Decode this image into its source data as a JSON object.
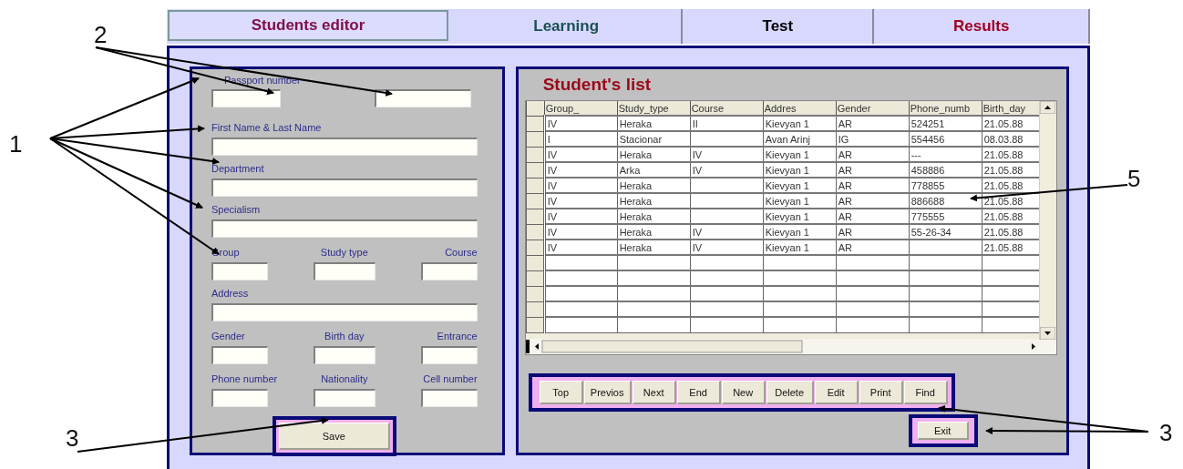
{
  "tabs": [
    {
      "label": "Students editor",
      "selected": true,
      "color": "#80104a"
    },
    {
      "label": "Learning",
      "selected": false,
      "color": "#1a5050"
    },
    {
      "label": "Test",
      "selected": false,
      "color": "#000000"
    },
    {
      "label": "Results",
      "selected": false,
      "color": "#a00020"
    }
  ],
  "editor": {
    "rows": [
      {
        "kind": "passport",
        "label": "Passport number"
      },
      {
        "kind": "full",
        "label": "First Name & Last Name"
      },
      {
        "kind": "full",
        "label": "Department"
      },
      {
        "kind": "full",
        "label": "Specialism"
      },
      {
        "kind": "triple",
        "labels": [
          "Group",
          "Study type",
          "Course"
        ]
      },
      {
        "kind": "full",
        "label": "Address"
      },
      {
        "kind": "triple",
        "labels": [
          "Gender",
          "Birth day",
          "Entrance"
        ]
      },
      {
        "kind": "triple",
        "labels": [
          "Phone number",
          "Nationality",
          "Cell number"
        ]
      }
    ],
    "save_button": "Save"
  },
  "list": {
    "title": "Student's list",
    "columns": [
      "Group_",
      "Study_type",
      "Course",
      "Addres",
      "Gender",
      "Phone_numb",
      "Birth_day"
    ],
    "rows": [
      [
        "IV",
        "Heraka",
        "II",
        "Kievyan 1",
        "AR",
        "524251",
        "21.05.88"
      ],
      [
        "I",
        "Stacionar",
        "",
        "Avan Arinj",
        "IG",
        "554456",
        "08.03.88"
      ],
      [
        "IV",
        "Heraka",
        "IV",
        "Kievyan 1",
        "AR",
        "---",
        "21.05.88"
      ],
      [
        "IV",
        "Arka",
        "IV",
        "Kievyan 1",
        "AR",
        "458886",
        "21.05.88"
      ],
      [
        "IV",
        "Heraka",
        "",
        "Kievyan 1",
        "AR",
        "778855",
        "21.05.88"
      ],
      [
        "IV",
        "Heraka",
        "",
        "Kievyan 1",
        "AR",
        "886688",
        "21.05.88"
      ],
      [
        "IV",
        "Heraka",
        "",
        "Kievyan 1",
        "AR",
        "775555",
        "21.05.88"
      ],
      [
        "IV",
        "Heraka",
        "IV",
        "Kievyan 1",
        "AR",
        "55-26-34",
        "21.05.88"
      ],
      [
        "IV",
        "Heraka",
        "IV",
        "Kievyan 1",
        "AR",
        "",
        "21.05.88"
      ]
    ],
    "nav_buttons": [
      "Top",
      "Previos",
      "Next",
      "End",
      "New",
      "Delete",
      "Edit",
      "Print",
      "Find"
    ],
    "exit_button": "Exit"
  },
  "annotations": [
    {
      "label": "1"
    },
    {
      "label": "2"
    },
    {
      "label": "3"
    },
    {
      "label": "3"
    },
    {
      "label": "5"
    }
  ]
}
